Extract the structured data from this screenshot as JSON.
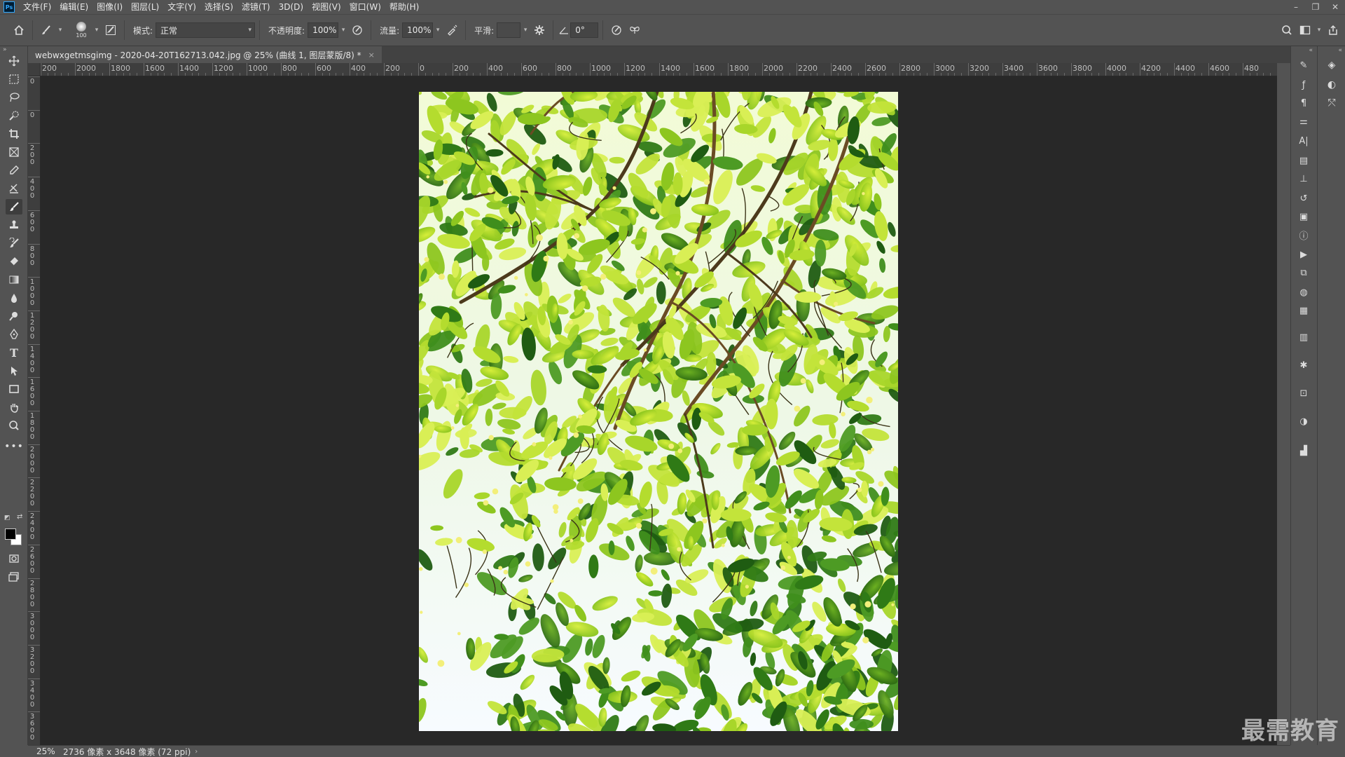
{
  "app": {
    "logo_text": "Ps",
    "menu": [
      "文件(F)",
      "编辑(E)",
      "图像(I)",
      "图层(L)",
      "文字(Y)",
      "选择(S)",
      "滤镜(T)",
      "3D(D)",
      "视图(V)",
      "窗口(W)",
      "帮助(H)"
    ],
    "window_controls": [
      "–",
      "❐",
      "✕"
    ]
  },
  "options": {
    "brush_size": "100",
    "mode_label": "模式:",
    "mode_value": "正常",
    "opacity_label": "不透明度:",
    "opacity_value": "100%",
    "flow_label": "流量:",
    "flow_value": "100%",
    "smooth_label": "平滑:",
    "smooth_value": "",
    "angle_value": "0°"
  },
  "document": {
    "tab_title": "webwxgetmsgimg - 2020-04-20T162713.042.jpg @ 25% (曲线 1, 图层蒙版/8) *",
    "close_glyph": "×"
  },
  "ruler": {
    "h_labels": [
      "200",
      "2000",
      "1800",
      "1600",
      "1400",
      "1200",
      "1000",
      "800",
      "600",
      "400",
      "200",
      "0",
      "200",
      "400",
      "600",
      "800",
      "1000",
      "1200",
      "1400",
      "1600",
      "1800",
      "2000",
      "2200",
      "2400",
      "2600",
      "2800",
      "3000",
      "3200",
      "3400",
      "3600",
      "3800",
      "4000",
      "4200",
      "4400",
      "4600",
      "480"
    ],
    "v_labels": [
      "0",
      "0",
      "200",
      "400",
      "600",
      "800",
      "1000",
      "1200",
      "1400",
      "1600",
      "1800",
      "2000",
      "2200",
      "2400",
      "2600",
      "2800",
      "3000",
      "3200",
      "3400",
      "3600"
    ]
  },
  "status": {
    "zoom": "25%",
    "doc_info": "2736 像素 x 3648 像素 (72 ppi)",
    "arrow": "›"
  },
  "watermark": "最需教育",
  "colors": {
    "ui_bg": "#535353",
    "canvas_bg": "#282828",
    "foreground_swatch": "#000000",
    "background_swatch": "#ffffff",
    "accent": "#31a8ff"
  },
  "icons": {
    "left_tools": [
      "move-icon",
      "marquee-icon",
      "lasso-icon",
      "quick-select-icon",
      "crop-icon",
      "frame-icon",
      "eyedropper-icon",
      "healing-icon",
      "brush-icon",
      "stamp-icon",
      "history-brush-icon",
      "eraser-icon",
      "gradient-icon",
      "blur-icon",
      "dodge-icon",
      "pen-icon",
      "type-icon",
      "path-select-icon",
      "rectangle-icon",
      "hand-icon",
      "zoom-icon",
      "more-tools-icon"
    ],
    "panel_col1": [
      "brush-settings-icon",
      "glyphs-icon",
      "paragraph-icon",
      "properties-icon",
      "character-icon",
      "libraries-icon",
      "clone-source-icon",
      "history-icon",
      "actions-icon",
      "info-icon",
      "play-icon",
      "swatches-icon",
      "color-icon",
      "table-icon",
      "notes-icon",
      "navigator-icon",
      "export-icon",
      "adjustments-icon",
      "histogram-icon"
    ],
    "panel_col2": [
      "layers-icon",
      "channels-icon",
      "paths-icon"
    ]
  }
}
